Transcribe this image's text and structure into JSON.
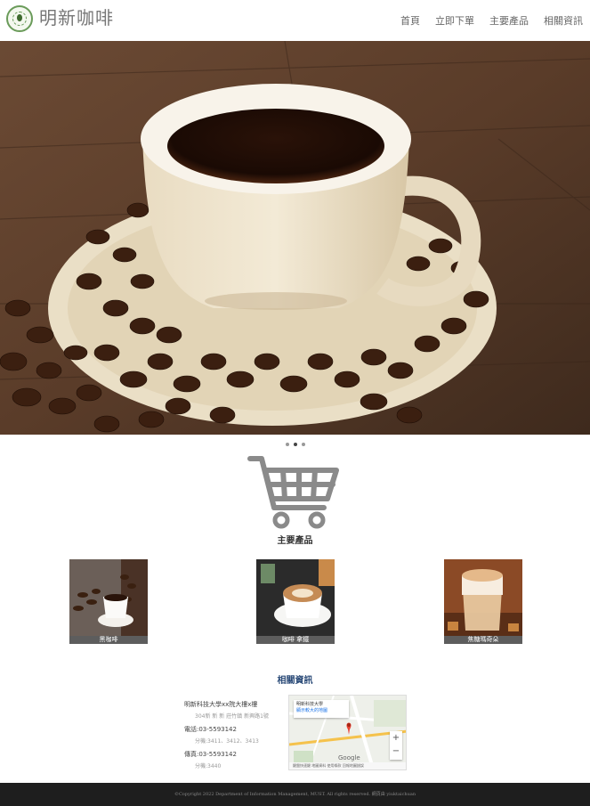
{
  "header": {
    "brand": "明新咖啡",
    "logo_icon": "coffee-badge-icon",
    "nav": [
      {
        "label": "首頁"
      },
      {
        "label": "立即下單"
      },
      {
        "label": "主要產品"
      },
      {
        "label": "相關資訊"
      }
    ]
  },
  "carousel": {
    "slides": 3,
    "active_index": 1
  },
  "products": {
    "icon": "shopping-cart-icon",
    "title": "主要產品",
    "items": [
      {
        "label": "黑咖啡"
      },
      {
        "label": "咖啡 拿鐵"
      },
      {
        "label": "焦糖瑪奇朵"
      }
    ]
  },
  "info": {
    "title": "相關資訊",
    "address": "明新科技大學xx院大樓x樓",
    "address_sub": "304新 新 新 莊竹鎮 新興路1號",
    "phone": "電話:03-5593142",
    "phone_sub": "分機:3411、3412、3413",
    "fax": "傳真:03-5593142",
    "fax_sub": "分機:3440",
    "map": {
      "place_name": "明新科技大學",
      "link": "顯示較大的地圖",
      "street_label": "明新科技大學",
      "google": "Google",
      "footer": "鍵盤快速鍵 地圖資料 使用條款 回報地圖錯誤"
    }
  },
  "footer": {
    "text": "©Copyright 2022 Department of Information Management, MUST. All rights reserved. 網頁由 yiuktaichuan"
  },
  "colors": {
    "info_title": "#2b4b78",
    "footer_bg": "#1e1e1e",
    "label_bg": "#5d5d5d"
  }
}
